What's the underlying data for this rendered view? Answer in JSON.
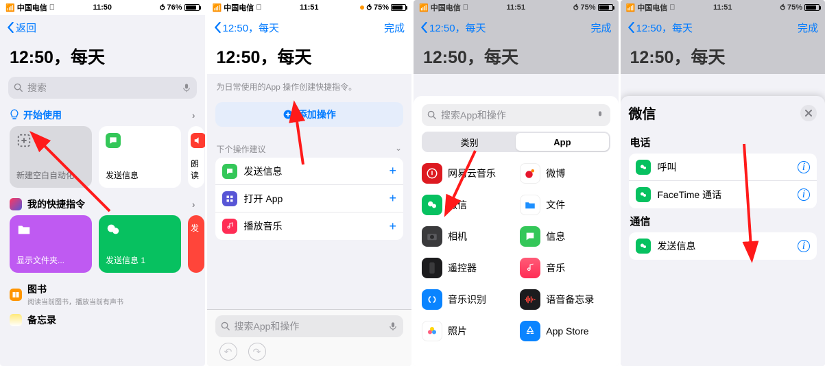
{
  "screen1": {
    "status": {
      "carrier": "中国电信",
      "time": "11:50",
      "battery": "76%",
      "signal": "􀙇"
    },
    "nav": {
      "back": "返回"
    },
    "title": "12:50，每天",
    "search": {
      "placeholder": "搜索"
    },
    "get_started": {
      "label": "开始使用"
    },
    "tiles_top": [
      {
        "label": "新建空白自动化"
      },
      {
        "label": "发送信息"
      },
      {
        "label": "朗读"
      }
    ],
    "my_shortcuts": {
      "label": "我的快捷指令"
    },
    "tiles_mine": [
      {
        "label": "显示文件夹..."
      },
      {
        "label": "发送信息 1"
      },
      {
        "label": "发"
      }
    ],
    "books": {
      "title": "图书",
      "sub": "阅读当前图书，播放当前有声书"
    },
    "notes": {
      "title": "备忘录"
    }
  },
  "screen2": {
    "status": {
      "carrier": "中国电信",
      "time": "11:51",
      "battery": "75%"
    },
    "nav": {
      "back": "12:50，每天",
      "done": "完成"
    },
    "title": "12:50，每天",
    "hint": "为日常使用的App 操作创建快捷指令。",
    "add_op": "添加操作",
    "suggest_caption": "下个操作建议",
    "suggestions": [
      {
        "label": "发送信息",
        "icon": "msg",
        "color": "#34c759"
      },
      {
        "label": "打开 App",
        "icon": "grid",
        "color": "#5856d6"
      },
      {
        "label": "播放音乐",
        "icon": "music",
        "color": "#ff2d55"
      }
    ],
    "bottom_search": "搜索App和操作"
  },
  "screen3": {
    "status": {
      "carrier": "中国电信",
      "time": "11:51",
      "battery": "75%"
    },
    "nav": {
      "back": "12:50，每天",
      "done": "完成"
    },
    "title": "12:50，每天",
    "search": {
      "placeholder": "搜索App和操作"
    },
    "seg": {
      "a": "类别",
      "b": "App"
    },
    "apps": [
      {
        "label": "网易云音乐",
        "color": "#dd1a21"
      },
      {
        "label": "微博",
        "color": "#ff8200"
      },
      {
        "label": "微信",
        "color": "#07c160"
      },
      {
        "label": "文件",
        "color": "#1e90ff"
      },
      {
        "label": "相机",
        "color": "#3a3a3c"
      },
      {
        "label": "信息",
        "color": "#34c759"
      },
      {
        "label": "遥控器",
        "color": "#1c1c1e"
      },
      {
        "label": "音乐",
        "color": "#ff2d55"
      },
      {
        "label": "音乐识别",
        "color": "#0a84ff"
      },
      {
        "label": "语音备忘录",
        "color": "#1c1c1e"
      },
      {
        "label": "照片",
        "color": "#ffd60a"
      },
      {
        "label": "App Store",
        "color": "#0a84ff"
      }
    ]
  },
  "screen4": {
    "status": {
      "carrier": "中国电信",
      "time": "11:51",
      "battery": "75%"
    },
    "nav": {
      "back": "12:50，每天",
      "done": "完成"
    },
    "title": "12:50，每天",
    "sheet_title": "微信",
    "sec_phone": "电话",
    "sec_comm": "通信",
    "phone_items": [
      {
        "label": "呼叫"
      },
      {
        "label": "FaceTime 通话"
      }
    ],
    "comm_items": [
      {
        "label": "发送信息"
      }
    ]
  }
}
